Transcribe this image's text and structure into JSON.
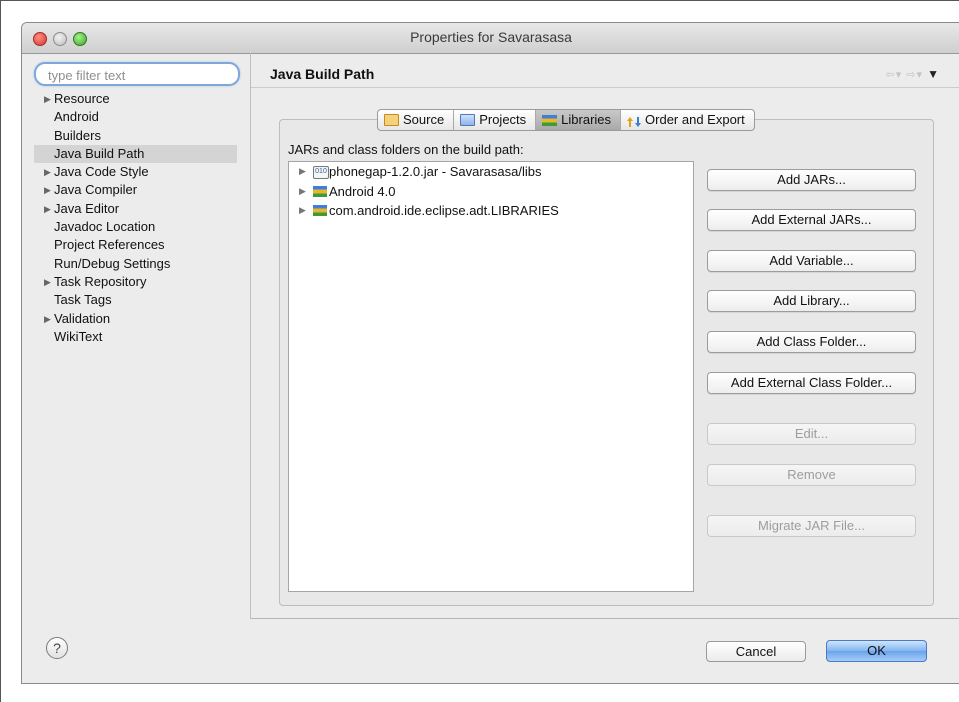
{
  "window": {
    "title": "Properties for Savarasasa"
  },
  "filter": {
    "placeholder": "type filter text"
  },
  "tree": {
    "items": [
      {
        "label": "Resource",
        "expandable": true
      },
      {
        "label": "Android",
        "expandable": false
      },
      {
        "label": "Builders",
        "expandable": false
      },
      {
        "label": "Java Build Path",
        "expandable": false,
        "selected": true
      },
      {
        "label": "Java Code Style",
        "expandable": true
      },
      {
        "label": "Java Compiler",
        "expandable": true
      },
      {
        "label": "Java Editor",
        "expandable": true
      },
      {
        "label": "Javadoc Location",
        "expandable": false
      },
      {
        "label": "Project References",
        "expandable": false
      },
      {
        "label": "Run/Debug Settings",
        "expandable": false
      },
      {
        "label": "Task Repository",
        "expandable": true
      },
      {
        "label": "Task Tags",
        "expandable": false
      },
      {
        "label": "Validation",
        "expandable": true
      },
      {
        "label": "WikiText",
        "expandable": false
      }
    ]
  },
  "pane": {
    "title": "Java Build Path",
    "tabs": [
      {
        "label": "Source",
        "icon": "source-folder-icon"
      },
      {
        "label": "Projects",
        "icon": "projects-folder-icon"
      },
      {
        "label": "Libraries",
        "icon": "libraries-icon",
        "active": true
      },
      {
        "label": "Order and Export",
        "icon": "order-export-icon"
      }
    ],
    "list_label": "JARs and class folders on the build path:",
    "entries": [
      {
        "label": "phonegap-1.2.0.jar - Savarasasa/libs",
        "icon": "jar-icon"
      },
      {
        "label": "Android 4.0",
        "icon": "library-icon"
      },
      {
        "label": "com.android.ide.eclipse.adt.LIBRARIES",
        "icon": "library-icon"
      }
    ],
    "buttons": {
      "add_jars": "Add JARs...",
      "add_external_jars": "Add External JARs...",
      "add_variable": "Add Variable...",
      "add_library": "Add Library...",
      "add_class_folder": "Add Class Folder...",
      "add_external_class_folder": "Add External Class Folder...",
      "edit": "Edit...",
      "remove": "Remove",
      "migrate_jar": "Migrate JAR File..."
    }
  },
  "footer": {
    "help_glyph": "?",
    "cancel": "Cancel",
    "ok": "OK"
  },
  "colors": {
    "ok_button": "#82b5f0",
    "close_light": "#d8362c",
    "min_light": "#bcbcbc",
    "max_light": "#3da52a"
  }
}
